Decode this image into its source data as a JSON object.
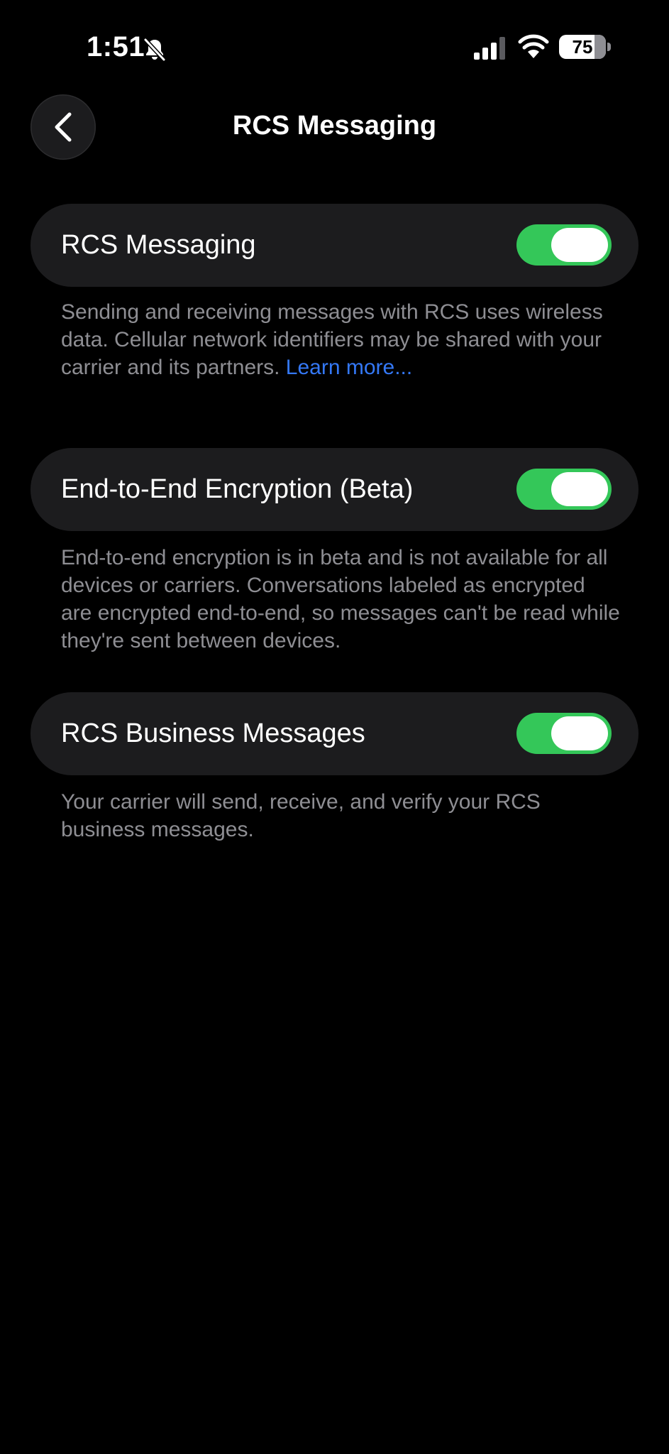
{
  "status_bar": {
    "time": "1:51",
    "battery_percent": "75",
    "battery_level": 0.75,
    "icons": [
      "bell-slash-icon",
      "signal-icon",
      "wifi-icon",
      "battery-icon"
    ]
  },
  "nav": {
    "title": "RCS Messaging",
    "back_icon": "chevron-left-icon"
  },
  "settings": [
    {
      "label": "RCS Messaging",
      "enabled": true,
      "footer": "Sending and receiving messages with RCS uses wireless data. Cellular network identifiers may be shared with your carrier and its partners.",
      "link": "Learn more..."
    },
    {
      "label": "End-to-End Encryption (Beta)",
      "enabled": true,
      "footer": "End-to-end encryption is in beta and is not available for all devices or carriers. Conversations labeled as encrypted are encrypted end-to-end, so messages can't be read while they're sent between devices."
    },
    {
      "label": "RCS Business Messages",
      "enabled": true,
      "footer": "Your carrier will send, receive, and verify your RCS business messages."
    }
  ],
  "colors": {
    "background": "#000000",
    "card": "#1c1c1e",
    "toggle_on": "#34c759",
    "footer_text": "#8e8e93",
    "link": "#3478f6"
  }
}
